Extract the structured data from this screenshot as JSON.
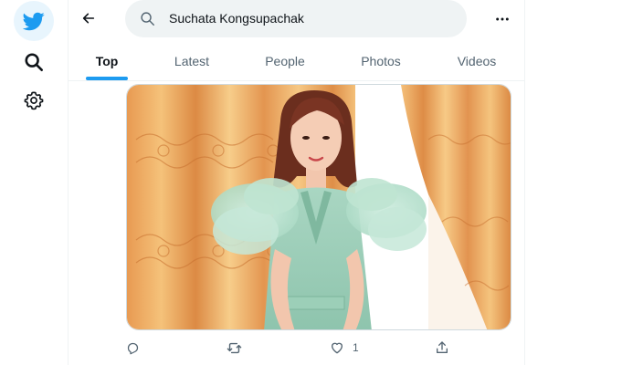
{
  "search": {
    "query": "Suchata Kongsupachak"
  },
  "tabs": [
    {
      "label": "Top"
    },
    {
      "label": "Latest"
    },
    {
      "label": "People"
    },
    {
      "label": "Photos"
    },
    {
      "label": "Videos"
    }
  ],
  "active_tab": "Top",
  "tweet": {
    "reply_count": "",
    "retweet_count": "",
    "like_count": "1"
  },
  "icons": {
    "logo": "twitter-bird-icon",
    "explore": "search-icon",
    "settings": "gear-icon",
    "back": "arrow-left-icon",
    "more": "more-horizontal-icon"
  },
  "colors": {
    "accent": "#1d9bf0",
    "search_bg": "#eff3f4",
    "muted_text": "#536471"
  }
}
